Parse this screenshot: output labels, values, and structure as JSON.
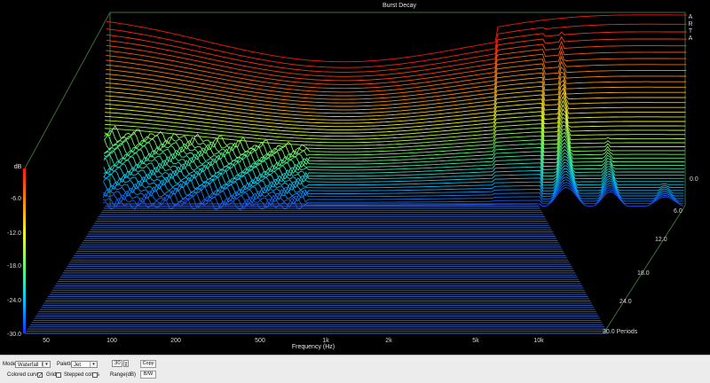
{
  "chart": {
    "title": "Burst Decay",
    "brand": [
      "A",
      "R",
      "T",
      "A"
    ],
    "ylabel": "dB",
    "xlabel": "Frequency (Hz)",
    "freq_ticks": [
      "50",
      "100",
      "200",
      "500",
      "1k",
      "2k",
      "5k",
      "10k"
    ],
    "db_ticks": [
      "-6.0",
      "-12.0",
      "-18.0",
      "-24.0",
      "-30.0"
    ],
    "period_ticks": [
      "0.0",
      "6.0",
      "12.0",
      "18.0",
      "24.0",
      "30.0 Periods"
    ],
    "colors": {
      "background": "#000000",
      "axis": "#2e6b2e",
      "baseline": "#3f6fd8"
    }
  },
  "chart_data": {
    "type": "area",
    "title": "Burst Decay",
    "xlabel": "Frequency (Hz)",
    "ylabel": "dB",
    "zlabel": "Periods",
    "x_scale": "log",
    "xlim": [
      35,
      20000
    ],
    "ylim": [
      -30,
      0
    ],
    "zlim": [
      0,
      30
    ],
    "frequencies": [
      40,
      100,
      200,
      500,
      1000,
      2000,
      5000,
      8000,
      10000,
      12000,
      16000
    ],
    "series": [
      {
        "values": [
          -1.5,
          -2,
          -2.5,
          -4,
          -4.5,
          -4.5,
          -3,
          -1,
          -1.5,
          -2,
          -4
        ]
      },
      {
        "values": [
          -10,
          -11,
          -12,
          -13,
          -13,
          -12.5,
          -11,
          -7,
          -4,
          -9,
          -11
        ]
      },
      {
        "values": [
          -22,
          -23,
          -24,
          -24.5,
          -24.5,
          -24,
          -23,
          -17,
          -8,
          -18,
          -17
        ]
      },
      {
        "values": [
          -30,
          -30,
          -30,
          -30,
          -30,
          -30,
          -30,
          -28,
          -12,
          -26,
          -20
        ]
      }
    ]
  },
  "controls": {
    "mode_label": "Mode",
    "mode_value": "Waterfall_F",
    "palette_label": "Palette",
    "palette_value": "Jet",
    "range_value": "30",
    "range_label": "Range(dB)",
    "copy_label": "Copy",
    "bw_label": "B/W",
    "colored_curves_label": "Colored curves",
    "grid_label": "Grid",
    "stepped_colors_label": "Stepped colors"
  }
}
